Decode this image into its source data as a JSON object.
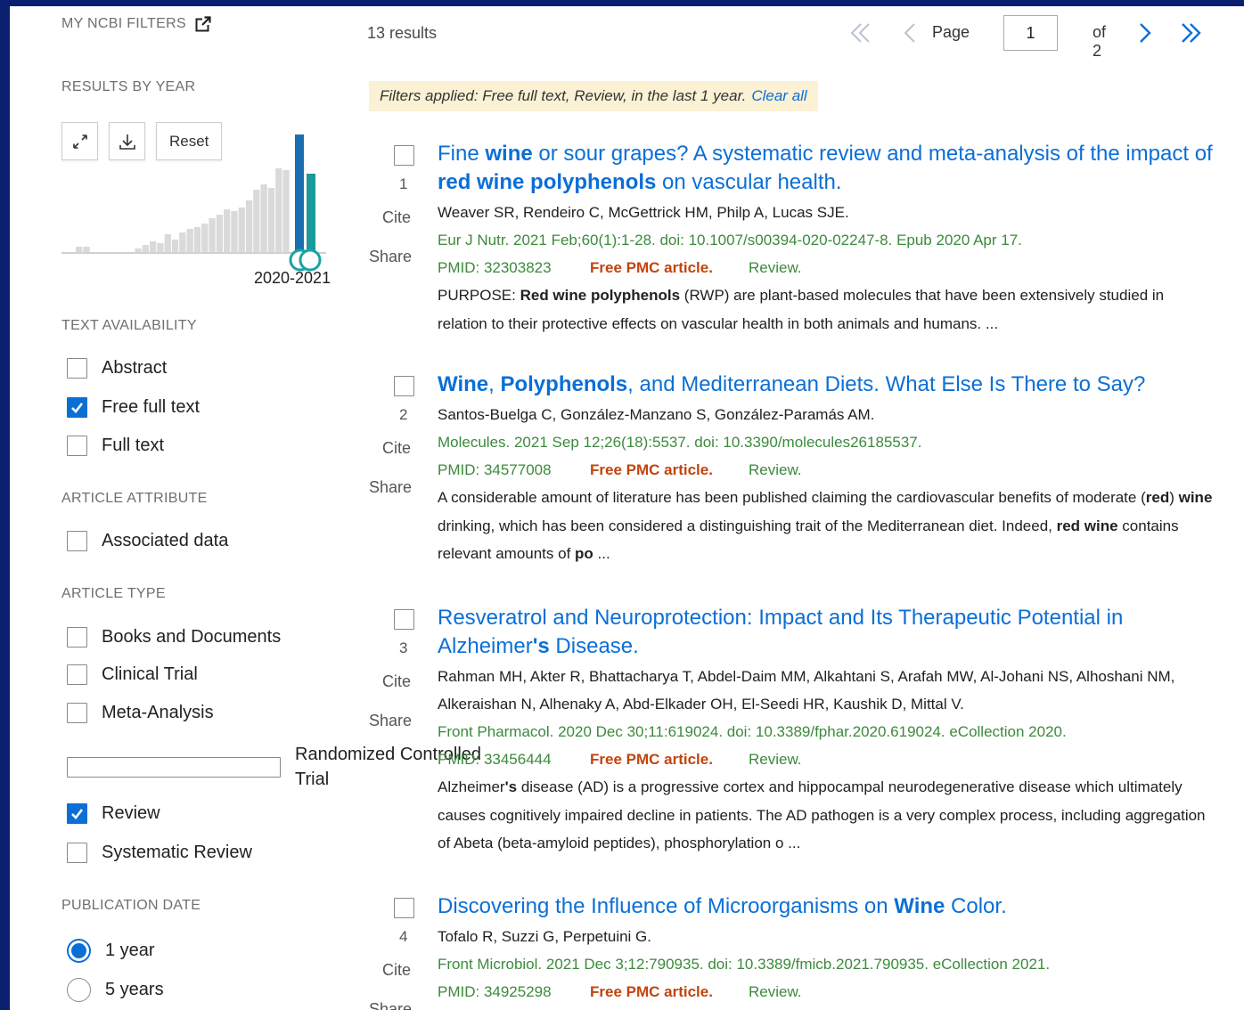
{
  "colors": {
    "frame": "#0b1f70",
    "accent": "#0b6fd6",
    "pmc": "#c1440e",
    "citation": "#3c8a3c",
    "banner": "#fbf1d4"
  },
  "sidebar": {
    "my_ncbi_filters": "MY NCBI FILTERS",
    "results_by_year": "RESULTS BY YEAR",
    "reset_label": "Reset",
    "year_range_label": "2020-2021",
    "text_availability": {
      "title": "TEXT AVAILABILITY",
      "items": [
        {
          "label": "Abstract",
          "checked": false
        },
        {
          "label": "Free full text",
          "checked": true
        },
        {
          "label": "Full text",
          "checked": false
        }
      ]
    },
    "article_attribute": {
      "title": "ARTICLE ATTRIBUTE",
      "items": [
        {
          "label": "Associated data",
          "checked": false
        }
      ]
    },
    "article_type": {
      "title": "ARTICLE TYPE",
      "items": [
        {
          "label": "Books and Documents",
          "checked": false
        },
        {
          "label": "Clinical Trial",
          "checked": false
        },
        {
          "label": "Meta-Analysis",
          "checked": false
        },
        {
          "label": "Randomized Controlled Trial",
          "checked": false
        },
        {
          "label": "Review",
          "checked": true
        },
        {
          "label": "Systematic Review",
          "checked": false
        }
      ]
    },
    "publication_date": {
      "title": "PUBLICATION DATE",
      "items": [
        {
          "label": "1 year",
          "selected": true
        },
        {
          "label": "5 years",
          "selected": false
        }
      ]
    }
  },
  "header": {
    "results_count": "13 results",
    "page_label": "Page",
    "page_value": "1",
    "of_label": "of 2"
  },
  "filters_banner": {
    "text": "Filters applied: Free full text, Review, in the last 1 year.",
    "clear_label": "Clear all"
  },
  "labels": {
    "cite": "Cite",
    "share": "Share"
  },
  "results": [
    {
      "number": "1",
      "title_parts": [
        {
          "t": "Fine ",
          "b": false
        },
        {
          "t": "wine",
          "b": true
        },
        {
          "t": " or sour grapes? A systematic review and meta-analysis of the impact of ",
          "b": false
        },
        {
          "t": "red wine polyphenols",
          "b": true
        },
        {
          "t": " on vascular health.",
          "b": false
        }
      ],
      "authors": "Weaver SR, Rendeiro C, McGettrick HM, Philp A, Lucas SJE.",
      "citation": "Eur J Nutr. 2021 Feb;60(1):1-28. doi: 10.1007/s00394-020-02247-8. Epub 2020 Apr 17.",
      "pmid": "PMID: 32303823",
      "pmc": "Free PMC article.",
      "type": "Review.",
      "snippet_parts": [
        {
          "t": "PURPOSE: ",
          "b": false
        },
        {
          "t": "Red wine polyphenols",
          "b": true
        },
        {
          "t": " (RWP) are plant-based molecules that have been extensively studied in relation to their protective effects on vascular health in both animals and humans. ...",
          "b": false
        }
      ]
    },
    {
      "number": "2",
      "title_parts": [
        {
          "t": "Wine",
          "b": true
        },
        {
          "t": ", ",
          "b": false
        },
        {
          "t": "Polyphenols",
          "b": true
        },
        {
          "t": ", and Mediterranean Diets. What Else Is There to Say?",
          "b": false
        }
      ],
      "authors": "Santos-Buelga C, González-Manzano S, González-Paramás AM.",
      "citation": "Molecules. 2021 Sep 12;26(18):5537. doi: 10.3390/molecules26185537.",
      "pmid": "PMID: 34577008",
      "pmc": "Free PMC article.",
      "type": "Review.",
      "snippet_parts": [
        {
          "t": "A considerable amount of literature has been published claiming the cardiovascular benefits of moderate (",
          "b": false
        },
        {
          "t": "red",
          "b": true
        },
        {
          "t": ") ",
          "b": false
        },
        {
          "t": "wine",
          "b": true
        },
        {
          "t": " drinking, which has been considered a distinguishing trait of the Mediterranean diet. Indeed, ",
          "b": false
        },
        {
          "t": "red wine",
          "b": true
        },
        {
          "t": " contains relevant amounts of ",
          "b": false
        },
        {
          "t": "po",
          "b": true
        },
        {
          "t": " ...",
          "b": false
        }
      ]
    },
    {
      "number": "3",
      "title_parts": [
        {
          "t": "Resveratrol and Neuroprotection: Impact and Its Therapeutic Potential in Alzheimer",
          "b": false
        },
        {
          "t": "'s",
          "b": true
        },
        {
          "t": " Disease.",
          "b": false
        }
      ],
      "authors": "Rahman MH, Akter R, Bhattacharya T, Abdel-Daim MM, Alkahtani S, Arafah MW, Al-Johani NS, Alhoshani NM, Alkeraishan N, Alhenaky A, Abd-Elkader OH, El-Seedi HR, Kaushik D, Mittal V.",
      "citation": "Front Pharmacol. 2020 Dec 30;11:619024. doi: 10.3389/fphar.2020.619024. eCollection 2020.",
      "pmid": "PMID: 33456444",
      "pmc": "Free PMC article.",
      "type": "Review.",
      "snippet_parts": [
        {
          "t": "Alzheimer",
          "b": false
        },
        {
          "t": "'s",
          "b": true
        },
        {
          "t": " disease (AD) is a progressive cortex and hippocampal neurodegenerative disease which ultimately causes cognitively impaired decline in patients. The AD pathogen is a very complex process, including aggregation of Abeta (beta-amyloid peptides), phosphorylation o ...",
          "b": false
        }
      ]
    },
    {
      "number": "4",
      "title_parts": [
        {
          "t": "Discovering the Influence of Microorganisms on ",
          "b": false
        },
        {
          "t": "Wine",
          "b": true
        },
        {
          "t": " Color.",
          "b": false
        }
      ],
      "authors": "Tofalo R, Suzzi G, Perpetuini G.",
      "citation": "Front Microbiol. 2021 Dec 3;12:790935. doi: 10.3389/fmicb.2021.790935. eCollection 2021.",
      "pmid": "PMID: 34925298",
      "pmc": "Free PMC article.",
      "type": "Review.",
      "snippet_parts": []
    }
  ]
}
